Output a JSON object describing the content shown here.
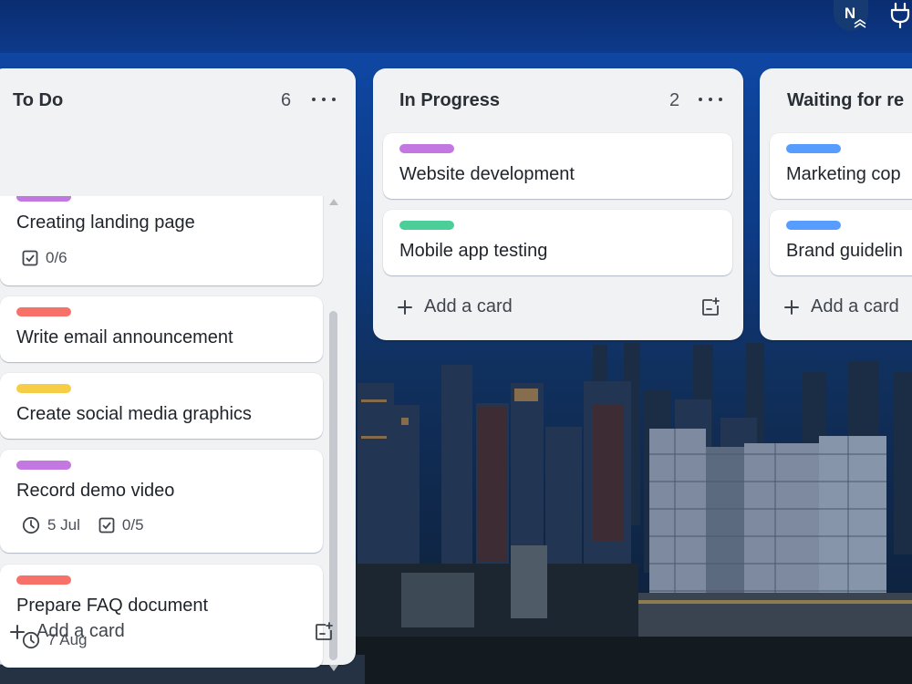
{
  "header": {
    "avatar_initial": "N"
  },
  "lists": {
    "todo": {
      "title": "To Do",
      "count": "6",
      "cards": [
        {
          "label_color": "#c377e0",
          "title": "Creating landing page",
          "checklist": "0/6"
        },
        {
          "label_color": "#f87168",
          "title": "Write email announcement"
        },
        {
          "label_color": "#f5cd47",
          "title": "Create social media graphics"
        },
        {
          "label_color": "#c377e0",
          "title": "Record demo video",
          "due": "5 Jul",
          "checklist": "0/5"
        },
        {
          "label_color": "#f87168",
          "title": "Prepare FAQ document",
          "due": "7 Aug"
        }
      ],
      "add_card": "Add a card"
    },
    "progress": {
      "title": "In Progress",
      "count": "2",
      "cards": [
        {
          "label_color": "#c377e0",
          "title": "Website development"
        },
        {
          "label_color": "#4bce97",
          "title": "Mobile app testing"
        }
      ],
      "add_card": "Add a card"
    },
    "waiting": {
      "title": "Waiting for re",
      "cards": [
        {
          "label_color": "#579dff",
          "title": "Marketing cop"
        },
        {
          "label_color": "#579dff",
          "title": "Brand guidelin"
        }
      ],
      "add_card": "Add a card"
    }
  },
  "icons": {
    "menu": "more-horizontal-icon",
    "add": "plus-icon",
    "template": "create-from-template-icon",
    "checklist": "checkbox-icon",
    "due": "clock-icon",
    "power": "power-ups-plug-icon"
  }
}
